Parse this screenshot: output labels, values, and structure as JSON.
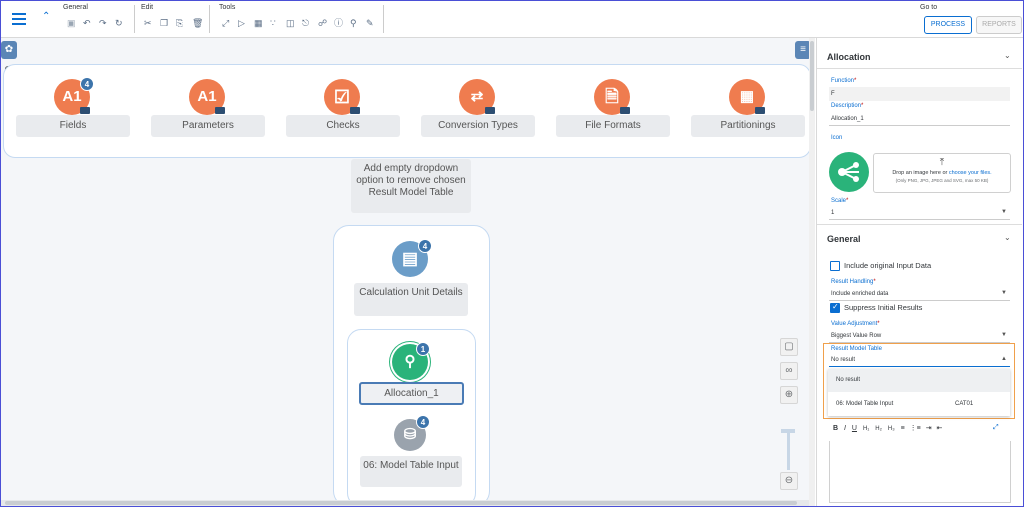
{
  "toolbar": {
    "groups": {
      "general": "General",
      "edit": "Edit",
      "tools": "Tools"
    },
    "goto_label": "Go to",
    "process_label": "PROCESS",
    "reports_label": "REPORTS"
  },
  "canvas": {
    "types": [
      {
        "label": "Fields",
        "icon_text": "A1",
        "badge": "4"
      },
      {
        "label": "Parameters",
        "icon_text": "A1"
      },
      {
        "label": "Checks"
      },
      {
        "label": "Conversion Types"
      },
      {
        "label": "File Formats"
      },
      {
        "label": "Partitionings"
      }
    ],
    "note": "Add empty dropdown option to remove chosen Result Model Table",
    "calc_unit": {
      "label": "Calculation Unit Details",
      "badge": "4"
    },
    "allocation": {
      "label": "Allocation_1",
      "badge": "1"
    },
    "model_table": {
      "label": "06: Model Table Input",
      "badge": "4"
    }
  },
  "panel": {
    "allocation_title": "Allocation",
    "function_label": "Function",
    "function_value": "F",
    "description_label": "Description",
    "description_value": "Allocation_1",
    "icon_label": "Icon",
    "drop_text_1": "Drop an image here or ",
    "drop_link": "choose your files.",
    "drop_hint": "(Only PNG, JPG, JPEG and SVG, max 50 KB)",
    "scale_label": "Scale",
    "scale_value": "1",
    "general_title": "General",
    "include_original": "Include original Input Data",
    "result_handling_label": "Result Handling",
    "result_handling_value": "Include enriched data",
    "suppress_initial": "Suppress Initial Results",
    "value_adjustment_label": "Value Adjustment",
    "value_adjustment_value": "Biggest Value Row",
    "result_model_label": "Result Model Table",
    "result_model_value": "No result",
    "dropdown_options": [
      {
        "label": "No result",
        "code": ""
      },
      {
        "label": "06: Model Table Input",
        "code": "CAT01"
      }
    ],
    "required_mark": "*"
  },
  "colors": {
    "accent": "#0a6ed1",
    "orange": "#ef7c4f",
    "green": "#2ab37a",
    "highlight": "#f0a04b"
  }
}
